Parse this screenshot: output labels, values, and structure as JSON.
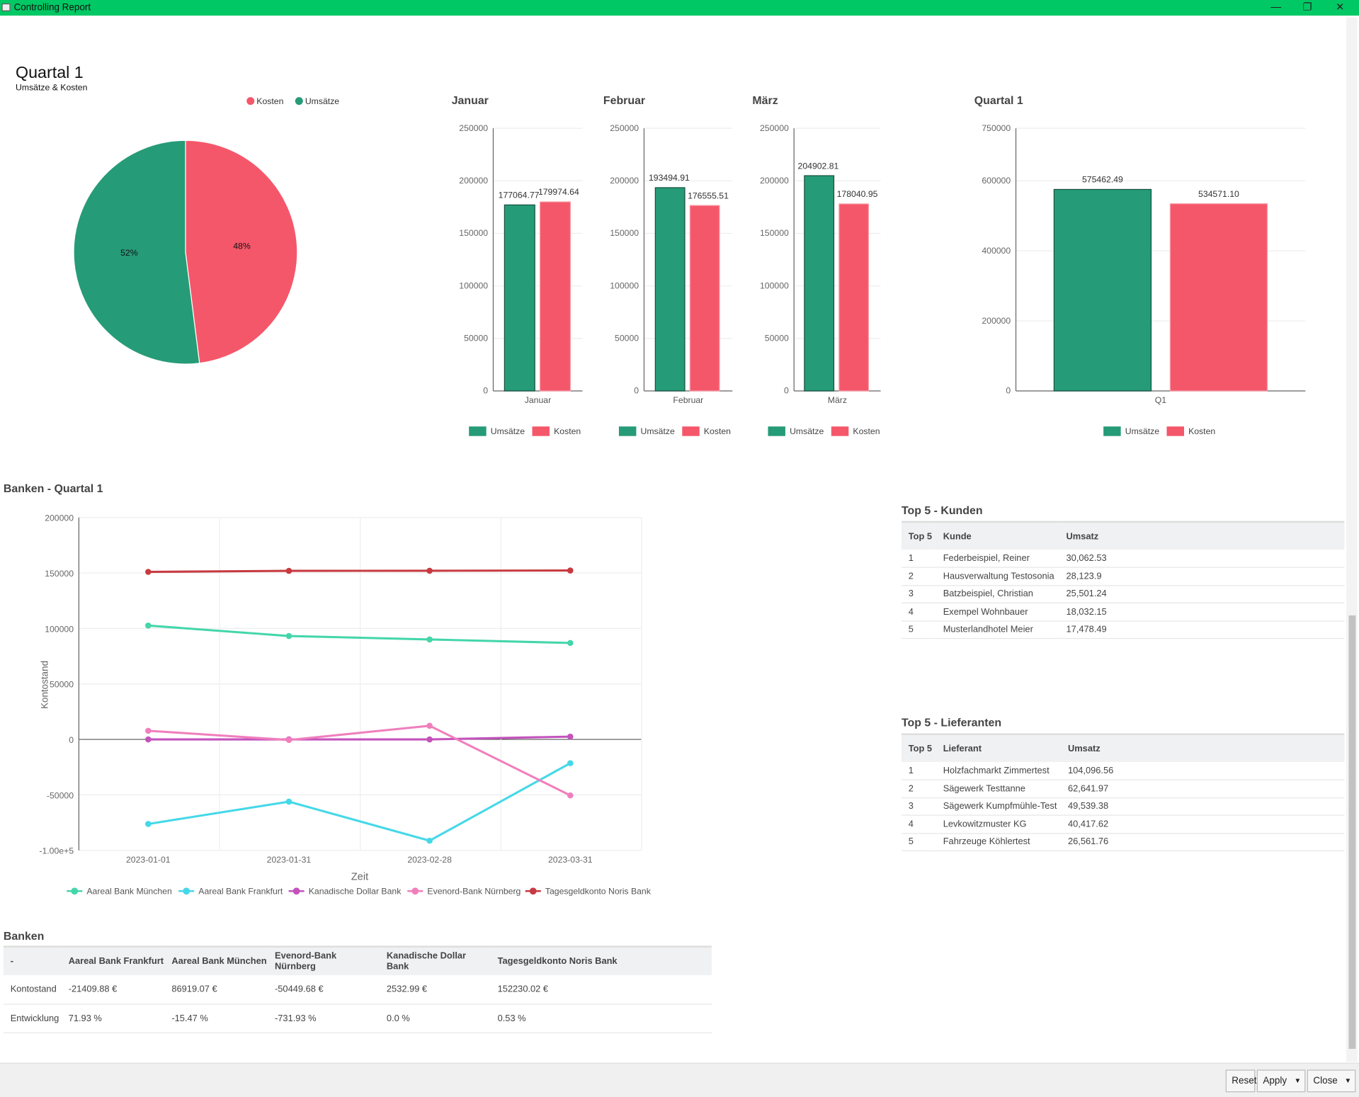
{
  "window": {
    "title": "Controlling Report",
    "minimize": "—",
    "restore": "❐",
    "close": "✕"
  },
  "header": {
    "title": "Quartal 1",
    "subtitle": "Umsätze & Kosten"
  },
  "colors": {
    "umsatz": "#269b77",
    "kosten": "#f5576a",
    "titlebar": "#00c864"
  },
  "pie": {
    "chart_data": {
      "type": "pie",
      "legend": [
        "Kosten",
        "Umsätze"
      ],
      "slices": [
        {
          "name": "Kosten",
          "value": 48,
          "label": "48%"
        },
        {
          "name": "Umsätze",
          "value": 52,
          "label": "52%"
        }
      ]
    }
  },
  "bars": [
    {
      "title": "Januar",
      "chart_data": {
        "type": "bar",
        "categories": [
          "Januar"
        ],
        "ylim": [
          0,
          250000
        ],
        "yticks": [
          "250000",
          "200000",
          "150000",
          "100000",
          "50000",
          "0"
        ],
        "series": [
          {
            "name": "Umsätze",
            "values": [
              177064.77
            ],
            "label": "177064.77"
          },
          {
            "name": "Kosten",
            "values": [
              179974.64
            ],
            "label": "179974.64"
          }
        ]
      }
    },
    {
      "title": "Februar",
      "chart_data": {
        "type": "bar",
        "categories": [
          "Februar"
        ],
        "ylim": [
          0,
          250000
        ],
        "yticks": [
          "250000",
          "200000",
          "150000",
          "100000",
          "50000",
          "0"
        ],
        "series": [
          {
            "name": "Umsätze",
            "values": [
              193494.91
            ],
            "label": "193494.91"
          },
          {
            "name": "Kosten",
            "values": [
              176555.51
            ],
            "label": "176555.51"
          }
        ]
      }
    },
    {
      "title": "März",
      "chart_data": {
        "type": "bar",
        "categories": [
          "März"
        ],
        "ylim": [
          0,
          250000
        ],
        "yticks": [
          "250000",
          "200000",
          "150000",
          "100000",
          "50000",
          "0"
        ],
        "series": [
          {
            "name": "Umsätze",
            "values": [
              204902.81
            ],
            "label": "204902.81"
          },
          {
            "name": "Kosten",
            "values": [
              178040.95
            ],
            "label": "178040.95"
          }
        ]
      }
    },
    {
      "title": "Quartal 1",
      "chart_data": {
        "type": "bar",
        "categories": [
          "Q1"
        ],
        "ylim": [
          0,
          750000
        ],
        "yticks": [
          "750000",
          "600000",
          "400000",
          "200000",
          "0"
        ],
        "series": [
          {
            "name": "Umsätze",
            "values": [
              575462.49
            ],
            "label": "575462.49"
          },
          {
            "name": "Kosten",
            "values": [
              534571.1
            ],
            "label": "534571.10"
          }
        ]
      }
    }
  ],
  "banks_chart": {
    "title": "Banken - Quartal 1",
    "chart_data": {
      "type": "line",
      "xlabel": "Zeit",
      "ylabel": "Kontostand",
      "x": [
        "2023-01-01",
        "2023-01-31",
        "2023-02-28",
        "2023-03-31"
      ],
      "ylim": [
        -100000,
        200000
      ],
      "yticks": [
        "200000",
        "150000",
        "100000",
        "50000",
        "0",
        "-50000",
        "-1.00e+5"
      ],
      "grid": true,
      "legend": "bottom",
      "series": [
        {
          "name": "Aareal Bank München",
          "color": "#44d6aa",
          "values": [
            102600,
            93200,
            90100,
            86919.07
          ]
        },
        {
          "name": "Aareal Bank Frankfurt",
          "color": "#45d8e8",
          "values": [
            -76200,
            -56100,
            -91300,
            -21409.88
          ]
        },
        {
          "name": "Kanadische Dollar Bank",
          "color": "#c452bc",
          "values": [
            0,
            0,
            0,
            2532.99
          ]
        },
        {
          "name": "Evenord-Bank Nürnberg",
          "color": "#f07fbc",
          "values": [
            7800,
            -500,
            12300,
            -50449.68
          ]
        },
        {
          "name": "Tagesgeldkonto Noris Bank",
          "color": "#c73a41",
          "values": [
            151000,
            151900,
            152000,
            152230.02
          ]
        }
      ]
    }
  },
  "kunden": {
    "title": "Top 5 - Kunden",
    "headers": [
      "Top 5",
      "Kunde",
      "Umsatz"
    ],
    "rows": [
      [
        "1",
        "Federbeispiel, Reiner",
        "30,062.53"
      ],
      [
        "2",
        "Hausverwaltung Testosonia",
        "28,123.9"
      ],
      [
        "3",
        "Batzbeispiel, Christian",
        "25,501.24"
      ],
      [
        "4",
        "Exempel Wohnbauer",
        "18,032.15"
      ],
      [
        "5",
        "Musterlandhotel Meier",
        "17,478.49"
      ]
    ]
  },
  "lieferanten": {
    "title": "Top 5 - Lieferanten",
    "headers": [
      "Top 5",
      "Lieferant",
      "Umsatz"
    ],
    "rows": [
      [
        "1",
        "Holzfachmarkt Zimmertest",
        "104,096.56"
      ],
      [
        "2",
        "Sägewerk Testtanne",
        "62,641.97"
      ],
      [
        "3",
        "Sägewerk Kumpfmühle-Test",
        "49,539.38"
      ],
      [
        "4",
        "Levkowitzmuster KG",
        "40,417.62"
      ],
      [
        "5",
        "Fahrzeuge Köhlertest",
        "26,561.76"
      ]
    ]
  },
  "banken": {
    "title": "Banken",
    "headers": [
      "-",
      "Aareal Bank Frankfurt",
      "Aareal Bank München",
      "Evenord-Bank Nürnberg",
      "Kanadische Dollar Bank",
      "Tagesgeldkonto Noris Bank"
    ],
    "rows": [
      [
        "Kontostand",
        "-21409.88 €",
        "86919.07 €",
        "-50449.68 €",
        "2532.99 €",
        "152230.02 €"
      ],
      [
        "Entwicklung",
        "71.93 %",
        "-15.47 %",
        "-731.93 %",
        "0.0 %",
        "0.53 %"
      ]
    ]
  },
  "footer": {
    "reset": "Reset",
    "apply": "Apply",
    "close": "Close"
  }
}
